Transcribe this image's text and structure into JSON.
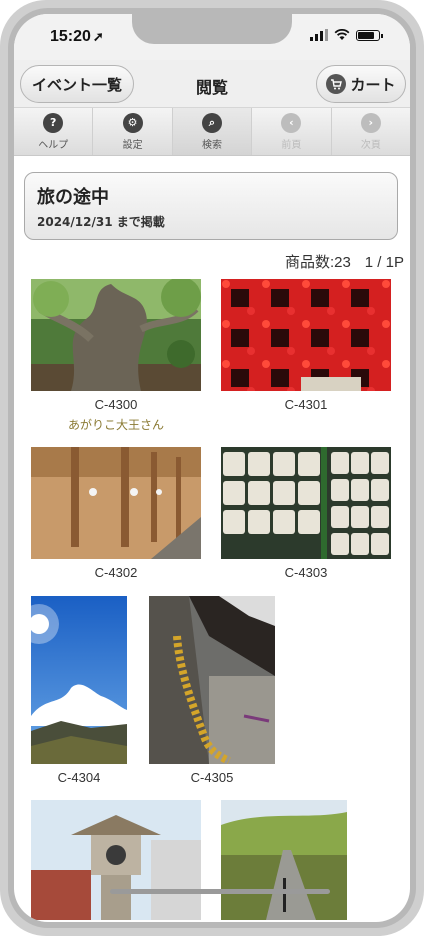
{
  "status_bar": {
    "time": "15:20",
    "location_arrow": "➚"
  },
  "navbar": {
    "back_label": "イベント一覧",
    "title": "閲覧",
    "cart_label": "カート",
    "cart_icon": "cart-icon"
  },
  "toolbar": [
    {
      "label": "ヘルプ",
      "icon": "?",
      "enabled": true
    },
    {
      "label": "設定",
      "icon": "⚙",
      "enabled": true
    },
    {
      "label": "検索",
      "icon": "⌕",
      "enabled": true
    },
    {
      "label": "前頁",
      "icon": "‹",
      "enabled": false
    },
    {
      "label": "次頁",
      "icon": "›",
      "enabled": false
    }
  ],
  "event": {
    "title": "旅の途中",
    "subtitle": "2024/12/31 まで掲載"
  },
  "listing": {
    "count_text": "商品数:23",
    "page_text": "1 / 1P"
  },
  "items": [
    {
      "code": "C-4300",
      "author": "あがりこ大王さん"
    },
    {
      "code": "C-4301",
      "author": ""
    },
    {
      "code": "C-4302",
      "author": ""
    },
    {
      "code": "C-4303",
      "author": ""
    },
    {
      "code": "C-4304",
      "author": ""
    },
    {
      "code": "C-4305",
      "author": ""
    }
  ],
  "colors": {
    "author_text": "#8a7a33",
    "toolbar_icon": "#444444",
    "disabled_icon": "#bdbdbd"
  }
}
